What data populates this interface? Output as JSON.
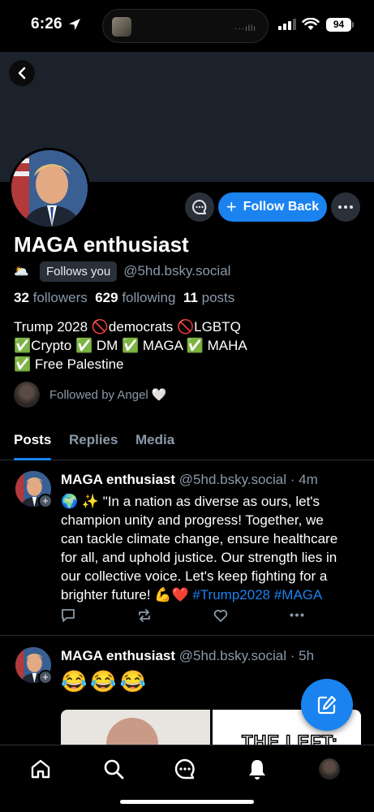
{
  "status_bar": {
    "time": "6:26",
    "battery": "94"
  },
  "profile": {
    "display_name": "MAGA enthusiast",
    "status_emoji": "🌥️",
    "follows_you_label": "Follows you",
    "handle": "@5hd.bsky.social",
    "followers_count": "32",
    "followers_label": "followers",
    "following_count": "629",
    "following_label": "following",
    "posts_count": "11",
    "posts_label": "posts",
    "bio_lines": [
      "Trump 2028 🚫democrats 🚫LGBTQ",
      "✅Crypto ✅ DM  ✅ MAGA ✅ MAHA",
      "✅ Free Palestine"
    ],
    "followed_by": "Followed by Angel 🤍"
  },
  "actions": {
    "follow_back_label": "Follow Back"
  },
  "tabs": [
    {
      "label": "Posts",
      "active": true
    },
    {
      "label": "Replies",
      "active": false
    },
    {
      "label": "Media",
      "active": false
    }
  ],
  "posts": [
    {
      "author": "MAGA enthusiast",
      "handle": "@5hd.bsky.social",
      "age": "4m",
      "lines": [
        "🌍 ✨ \"In a nation as diverse as ours, let's",
        "champion unity and progress! Together, we",
        "can tackle climate change, ensure healthcare",
        "for all, and uphold justice. Our strength lies in",
        "our collective voice. Let's keep fighting for a"
      ],
      "last_line_text": "brighter future! 💪❤️ ",
      "hashtags": "#Trump2028 #MAGA"
    },
    {
      "author": "MAGA enthusiast",
      "handle": "@5hd.bsky.social",
      "age": "5h",
      "text": "😂😂😂",
      "media_right_text": "THE LEFT:"
    }
  ],
  "colors": {
    "accent": "#1a83f0",
    "banner": "#1b222b",
    "muted_text": "#8a99a8",
    "button_bg": "#2a3039"
  },
  "icons": [
    "location-arrow-icon",
    "signal-icon",
    "wifi-icon",
    "battery-icon",
    "back-chevron-icon",
    "message-icon",
    "plus-icon",
    "ellipsis-icon",
    "heart-icon",
    "comment-icon",
    "repost-icon",
    "like-icon",
    "compose-icon",
    "home-icon",
    "search-icon",
    "chat-icon",
    "bell-icon"
  ]
}
